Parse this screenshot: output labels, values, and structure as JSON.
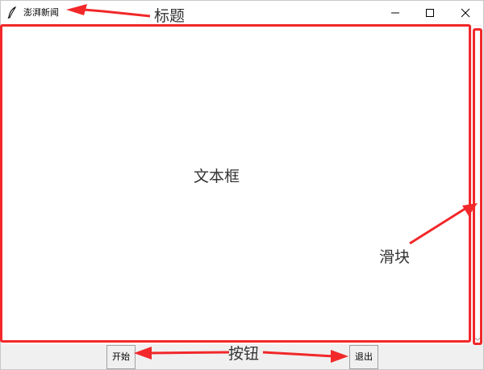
{
  "window": {
    "title": "澎湃新闻"
  },
  "buttons": {
    "start_label": "开始",
    "quit_label": "退出"
  },
  "annotations": {
    "title_label": "标题",
    "textbox_label": "文本框",
    "slider_label": "滑块",
    "button_label": "按钮",
    "color": "#f2282a"
  },
  "icons": {
    "app": "feather-icon",
    "minimize": "minimize-icon",
    "maximize": "maximize-icon",
    "close": "close-icon"
  }
}
